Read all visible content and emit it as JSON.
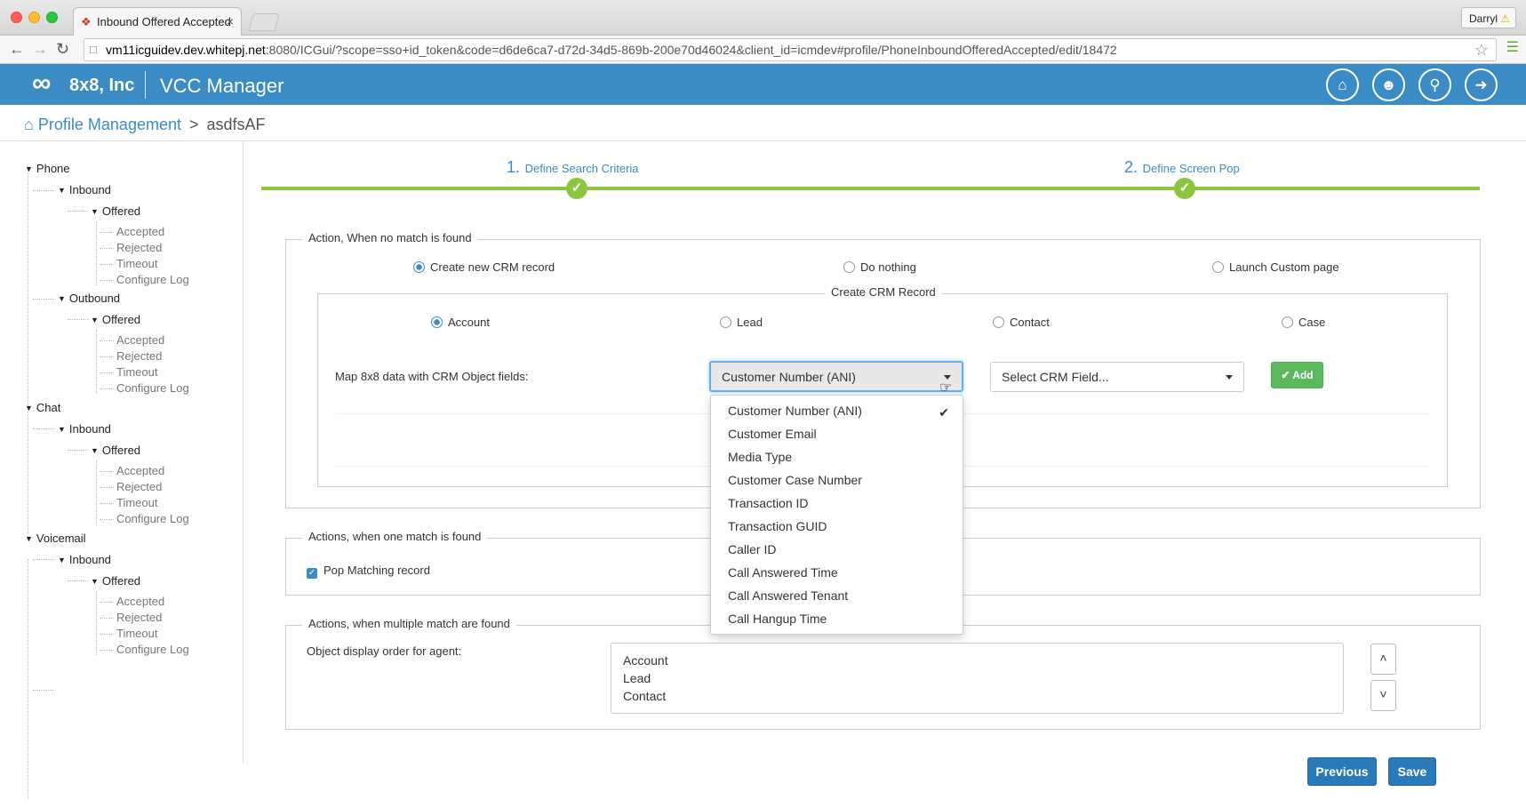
{
  "browser": {
    "tab_title": "Inbound Offered Accepted",
    "tab_close": "×",
    "profile": "Darryl",
    "url_host": "vm11icguidev.dev.whitepj.net",
    "url_rest": ":8080/ICGui/?scope=sso+id_token&code=d6de6ca7-d72d-34d5-869b-200e70d46024&client_id=icmdev#profile/PhoneInboundOfferedAccepted/edit/18472"
  },
  "header": {
    "brand": "8x8, Inc",
    "app_title": "VCC Manager"
  },
  "breadcrumb": {
    "root": "Profile Management",
    "separator": ">",
    "current": "asdfsAF"
  },
  "sidebar": {
    "phone": "Phone",
    "phone_inbound": "Inbound",
    "phone_inbound_offered": "Offered",
    "phone_inbound_leaves": [
      "Accepted",
      "Rejected",
      "Timeout",
      "Configure Log"
    ],
    "phone_outbound": "Outbound",
    "phone_outbound_offered": "Offered",
    "phone_outbound_leaves": [
      "Accepted",
      "Rejected",
      "Timeout",
      "Configure Log"
    ],
    "chat": "Chat",
    "chat_inbound": "Inbound",
    "chat_inbound_offered": "Offered",
    "chat_inbound_leaves": [
      "Accepted",
      "Rejected",
      "Timeout",
      "Configure Log"
    ],
    "voicemail": "Voicemail",
    "voicemail_inbound": "Inbound",
    "voicemail_inbound_offered": "Offered",
    "voicemail_inbound_leaves": [
      "Accepted",
      "Rejected",
      "Timeout",
      "Configure Log"
    ]
  },
  "wizard": {
    "step1_num": "1.",
    "step1_label": "Define Search Criteria",
    "step2_num": "2.",
    "step2_label": "Define Screen Pop"
  },
  "no_match": {
    "legend": "Action, When no match is found",
    "options": [
      "Create new CRM record",
      "Do nothing",
      "Launch Custom page"
    ],
    "selected": "Create new CRM record"
  },
  "create_crm": {
    "legend": "Create CRM Record",
    "objects": [
      "Account",
      "Lead",
      "Contact",
      "Case"
    ],
    "selected": "Account",
    "map_label": "Map 8x8 data with CRM Object fields:",
    "source_field_value": "Customer Number (ANI)",
    "crm_field_placeholder": "Select CRM Field...",
    "add_label": "✔ Add",
    "source_field_options": [
      "Customer Number (ANI)",
      "Customer Email",
      "Media Type",
      "Customer Case Number",
      "Transaction ID",
      "Transaction GUID",
      "Caller ID",
      "Call Answered Time",
      "Call Answered Tenant",
      "Call Hangup Time"
    ]
  },
  "one_match": {
    "legend": "Actions, when one match is found",
    "checkbox_label": "Pop Matching record",
    "checked": true
  },
  "multi_match": {
    "legend": "Actions, when multiple match are found",
    "order_label": "Object display order for agent:",
    "order_items": [
      "Account",
      "Lead",
      "Contact"
    ]
  },
  "footer": {
    "previous_label": "Previous",
    "save_label": "Save"
  },
  "colors": {
    "brand_blue": "#3b8cc4",
    "wizard_green": "#8cc63f",
    "add_green": "#5cb85c",
    "primary_button": "#2a79b8"
  }
}
